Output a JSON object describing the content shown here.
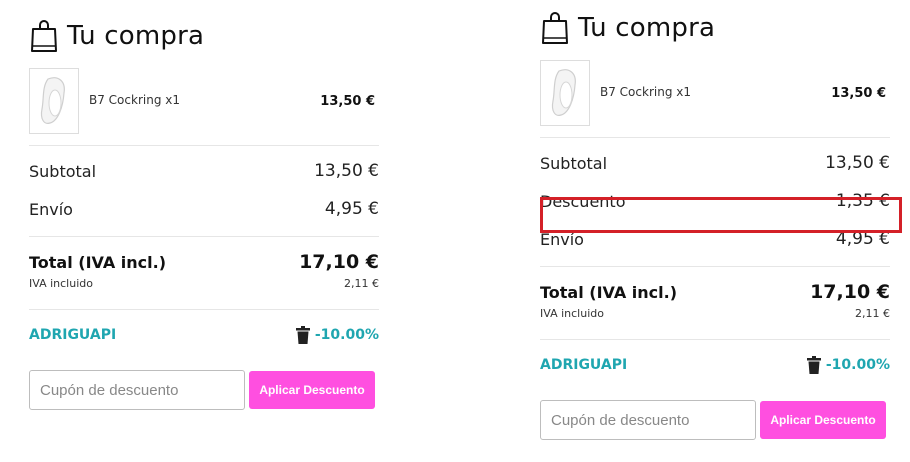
{
  "left": {
    "title": "Tu compra",
    "product": {
      "name": "B7 Cockring x1",
      "price": "13,50 €"
    },
    "subtotal": {
      "label": "Subtotal",
      "value": "13,50 €"
    },
    "shipping": {
      "label": "Envío",
      "value": "4,95 €"
    },
    "total": {
      "label": "Total (IVA incl.)",
      "value": "17,10 €"
    },
    "iva": {
      "label": "IVA incluido",
      "value": "2,11 €"
    },
    "coupon": {
      "code": "ADRIGUAPI",
      "discount": "-10.00%"
    },
    "coupon_input_placeholder": "Cupón de descuento",
    "apply_button": "Aplicar Descuento"
  },
  "right": {
    "title": "Tu compra",
    "product": {
      "name": "B7 Cockring x1",
      "price": "13,50 €"
    },
    "subtotal": {
      "label": "Subtotal",
      "value": "13,50 €"
    },
    "discount": {
      "label": "Descuento",
      "value": "1,35 €"
    },
    "shipping": {
      "label": "Envío",
      "value": "4,95 €"
    },
    "total": {
      "label": "Total (IVA incl.)",
      "value": "17,10 €"
    },
    "iva": {
      "label": "IVA incluido",
      "value": "2,11 €"
    },
    "coupon": {
      "code": "ADRIGUAPI",
      "discount": "-10.00%"
    },
    "coupon_input_placeholder": "Cupón de descuento",
    "apply_button": "Aplicar Descuento"
  },
  "colors": {
    "accent_teal": "#1fa6b0",
    "button_pink": "#ff4fe0",
    "highlight_red": "#d42028"
  },
  "icons": [
    "shopping-bag-icon",
    "trash-icon"
  ]
}
